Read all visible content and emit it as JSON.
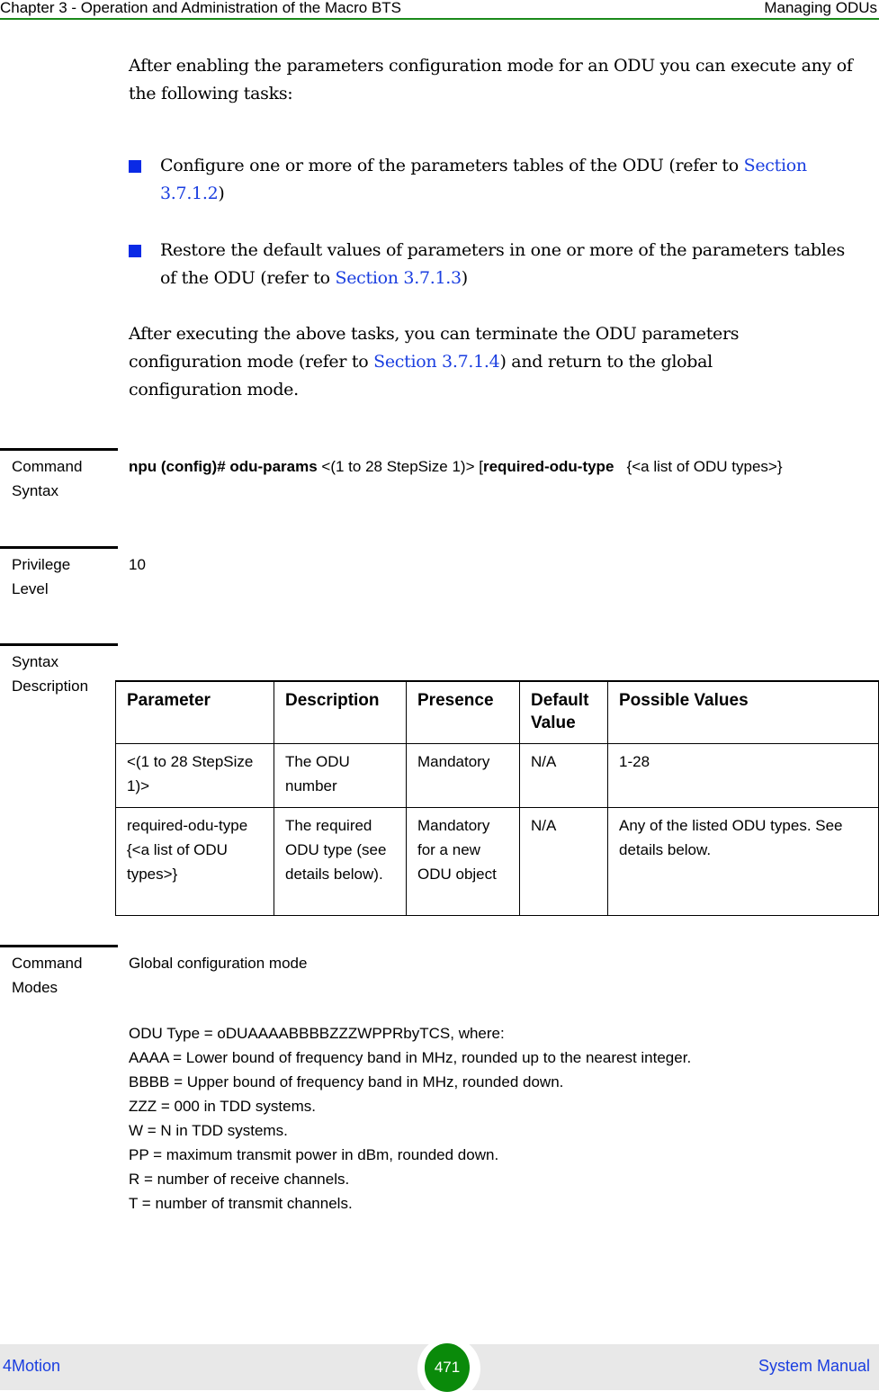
{
  "header": {
    "chapter": "Chapter 3 - Operation and Administration of the Macro BTS",
    "section": "Managing ODUs"
  },
  "intro": {
    "text": "After enabling the parameters configuration mode for an ODU you can execute any of the following tasks:"
  },
  "bullets": [
    {
      "before": "Configure one or more of the parameters tables of the ODU (refer to ",
      "link": "Section 3.7.1.2",
      "after": ")"
    },
    {
      "before": "Restore the default values of parameters in one or more of the parameters tables of the ODU (refer to ",
      "link": "Section 3.7.1.3",
      "after": ")"
    }
  ],
  "closing": {
    "before": "After executing the above tasks, you can terminate the ODU parameters configuration mode (refer to ",
    "link": "Section 3.7.1.4",
    "after": ") and return to the global configuration mode."
  },
  "command_syntax": {
    "label_line1": "Command",
    "label_line2": "Syntax",
    "prompt": "npu (config)# odu-params",
    "arg1": " <(1 to 28 StepSize 1)> [",
    "keyword": "required-odu-type",
    "arg2": "   {<a list of ODU types>}"
  },
  "privilege": {
    "label_line1": "Privilege",
    "label_line2": "Level",
    "value": "10"
  },
  "syntax_description": {
    "label_line1": "Syntax",
    "label_line2": "Description",
    "columns": [
      "Parameter",
      "Description",
      "Presence",
      "Default Value",
      "Possible Values"
    ],
    "rows": [
      [
        "<(1 to 28 StepSize 1)>",
        "The ODU number",
        "Mandatory",
        "N/A",
        "1-28"
      ],
      [
        "required-odu-type {<a list of ODU types>}",
        "The required ODU type (see details below).",
        "Mandatory for a new ODU object",
        "N/A",
        "Any of the listed ODU types. See details below."
      ]
    ]
  },
  "command_modes": {
    "label_line1": "Command",
    "label_line2": "Modes",
    "value": "Global configuration mode"
  },
  "odu_type_details": [
    "ODU Type = oDUAAAABBBBZZZWPPRbyTCS, where:",
    "AAAA = Lower bound of frequency band in MHz, rounded up to the nearest integer.",
    "BBBB = Upper bound of frequency band in MHz, rounded down.",
    "ZZZ = 000 in TDD systems.",
    "W = N in TDD systems.",
    "PP = maximum transmit power in dBm, rounded down.",
    "R = number of receive channels.",
    "T = number of transmit channels."
  ],
  "footer": {
    "left": "4Motion",
    "page": "471",
    "right": "System Manual"
  }
}
